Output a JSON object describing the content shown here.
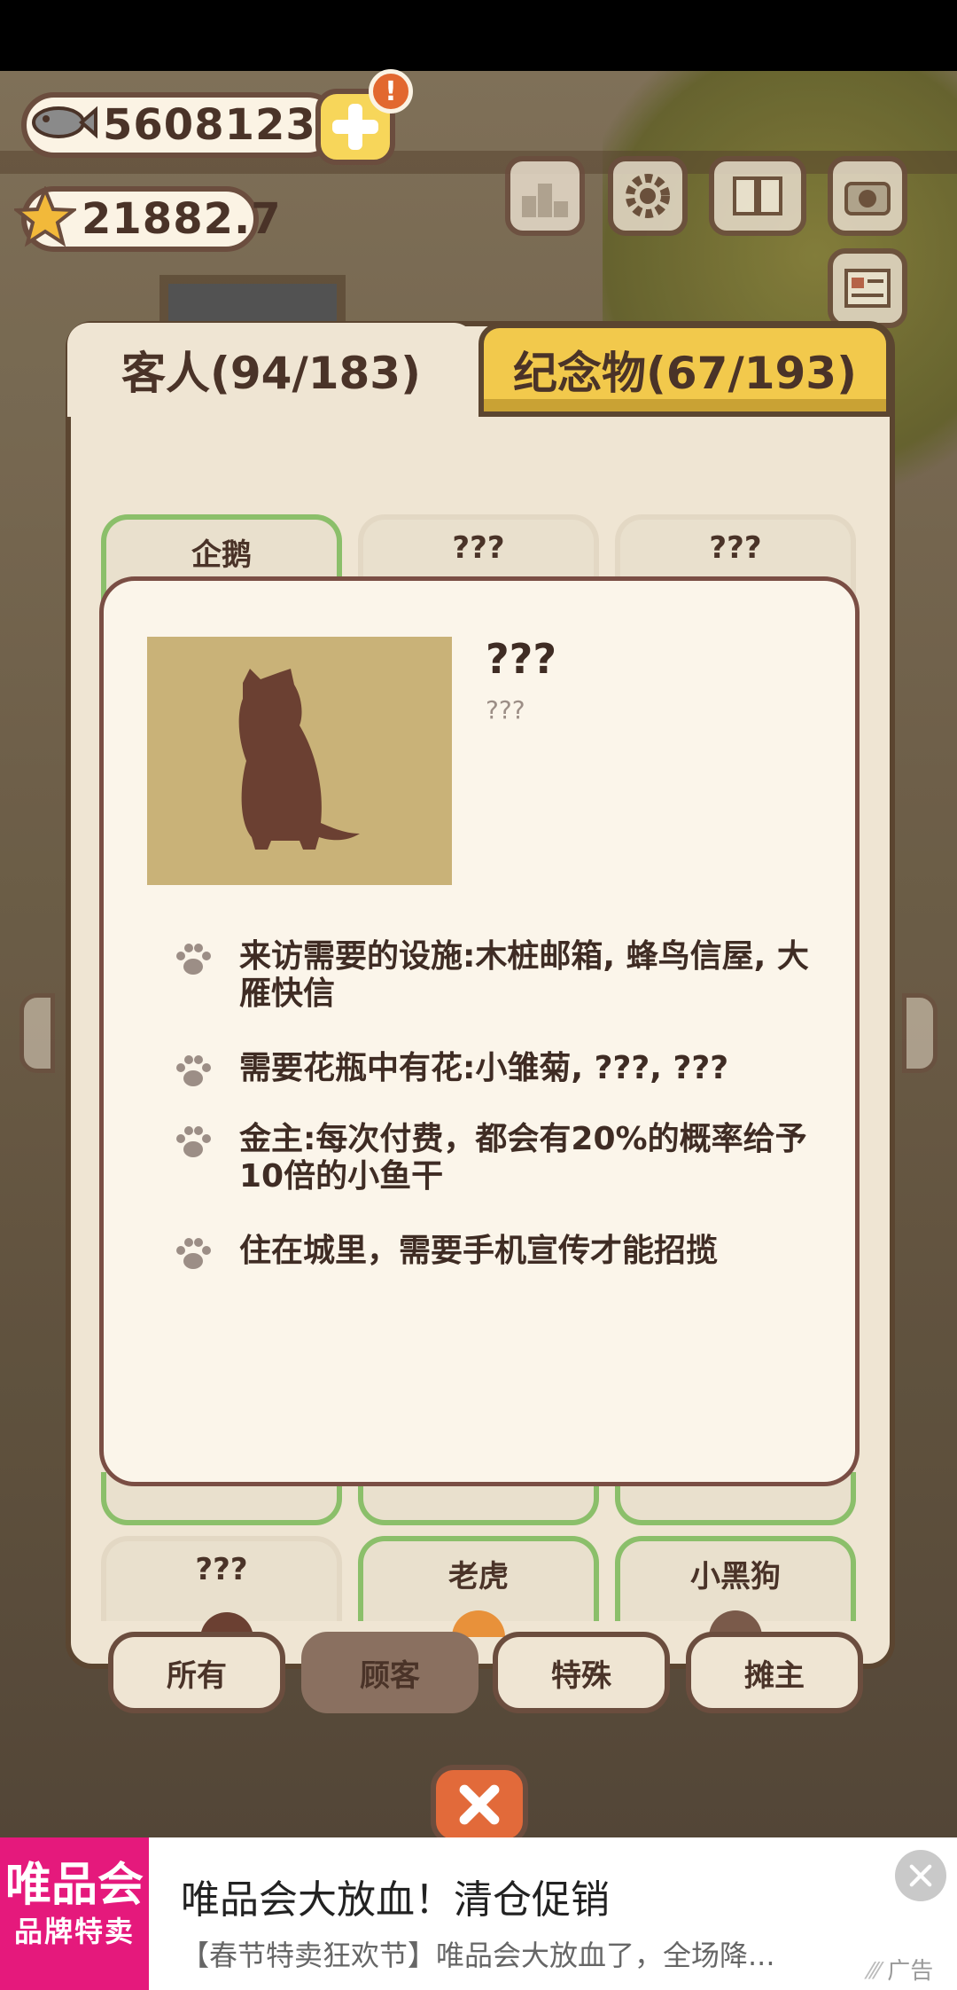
{
  "currency": {
    "fish": "5608123",
    "stars": "21882.7"
  },
  "plus_badge": "!",
  "tabs": {
    "guests": "客人(94/183)",
    "souvenirs": "纪念物(67/193)"
  },
  "grid": {
    "top_row": [
      "企鹅",
      "???",
      "???"
    ],
    "bottom_row": [
      "???",
      "老虎",
      "小黑狗"
    ]
  },
  "detail": {
    "name": "???",
    "subtitle": "???",
    "traits": [
      "来访需要的设施:木桩邮箱, 蜂鸟信屋, 大雁快信",
      "需要花瓶中有花:小雏菊, ???, ???",
      "金主:每次付费，都会有20%的概率给予10倍的小鱼干",
      "住在城里，需要手机宣传才能招揽"
    ]
  },
  "filters": [
    "所有",
    "顾客",
    "特殊",
    "摊主"
  ],
  "active_filter": "顾客",
  "ad": {
    "logo_line1": "唯品会",
    "logo_line2": "品牌特卖",
    "title": "唯品会大放血！清仓促销",
    "body": "【春节特卖狂欢节】唯品会大放血了，全场降...",
    "tag": "广告"
  },
  "colors": {
    "accent_yellow": "#f2c94c",
    "card_border": "#7a4e44",
    "green_frame": "#8bbf6a",
    "ad_brand": "#e5197c"
  }
}
